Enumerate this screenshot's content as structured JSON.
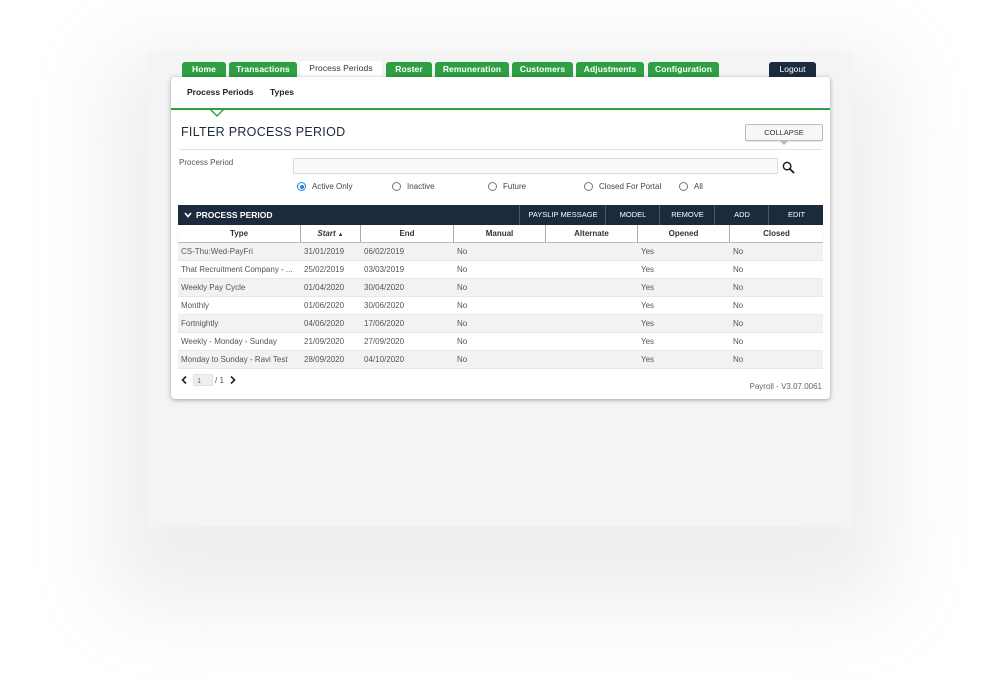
{
  "tabs": [
    {
      "label": "Home",
      "active": false
    },
    {
      "label": "Transactions",
      "active": false
    },
    {
      "label": "Process Periods",
      "active": true
    },
    {
      "label": "Roster",
      "active": false
    },
    {
      "label": "Remuneration",
      "active": false
    },
    {
      "label": "Customers",
      "active": false
    },
    {
      "label": "Adjustments",
      "active": false
    },
    {
      "label": "Configuration",
      "active": false
    }
  ],
  "logout_label": "Logout",
  "subnav": [
    "Process Periods",
    "Types"
  ],
  "filter": {
    "title": "FILTER PROCESS PERIOD",
    "collapse_label": "COLLAPSE",
    "field_label": "Process Period",
    "field_value": "",
    "field_placeholder": "",
    "radios": [
      {
        "label": "Active Only",
        "checked": true
      },
      {
        "label": "Inactive",
        "checked": false
      },
      {
        "label": "Future",
        "checked": false
      },
      {
        "label": "Closed For Portal",
        "checked": false
      },
      {
        "label": "All",
        "checked": false
      }
    ]
  },
  "table": {
    "title": "PROCESS PERIOD",
    "actions": [
      "PAYSLIP MESSAGE",
      "MODEL",
      "REMOVE",
      "ADD",
      "EDIT"
    ],
    "columns": [
      "Type",
      "Start",
      "End",
      "Manual",
      "Alternate",
      "Opened",
      "Closed"
    ],
    "sort_column": "Start",
    "sort_indicator": "▲",
    "rows": [
      [
        "CS-Thu:Wed-PayFri",
        "31/01/2019",
        "06/02/2019",
        "No",
        "",
        "Yes",
        "No"
      ],
      [
        "That Recruitment Company - ...",
        "25/02/2019",
        "03/03/2019",
        "No",
        "",
        "Yes",
        "No"
      ],
      [
        "Weekly Pay Cycle",
        "01/04/2020",
        "30/04/2020",
        "No",
        "",
        "Yes",
        "No"
      ],
      [
        "Monthly",
        "01/06/2020",
        "30/06/2020",
        "No",
        "",
        "Yes",
        "No"
      ],
      [
        "Fortnightly",
        "04/06/2020",
        "17/06/2020",
        "No",
        "",
        "Yes",
        "No"
      ],
      [
        "Weekly - Monday - Sunday",
        "21/09/2020",
        "27/09/2020",
        "No",
        "",
        "Yes",
        "No"
      ],
      [
        "Monday to Sunday - Ravi Test",
        "28/09/2020",
        "04/10/2020",
        "No",
        "",
        "Yes",
        "No"
      ]
    ]
  },
  "pager": {
    "current": "1",
    "total": "/ 1"
  },
  "version": "Payroll - V3.07.0061",
  "colors": {
    "accent": "#2ea043",
    "navy": "#1b2a3d",
    "radio": "#2a7fd4"
  }
}
